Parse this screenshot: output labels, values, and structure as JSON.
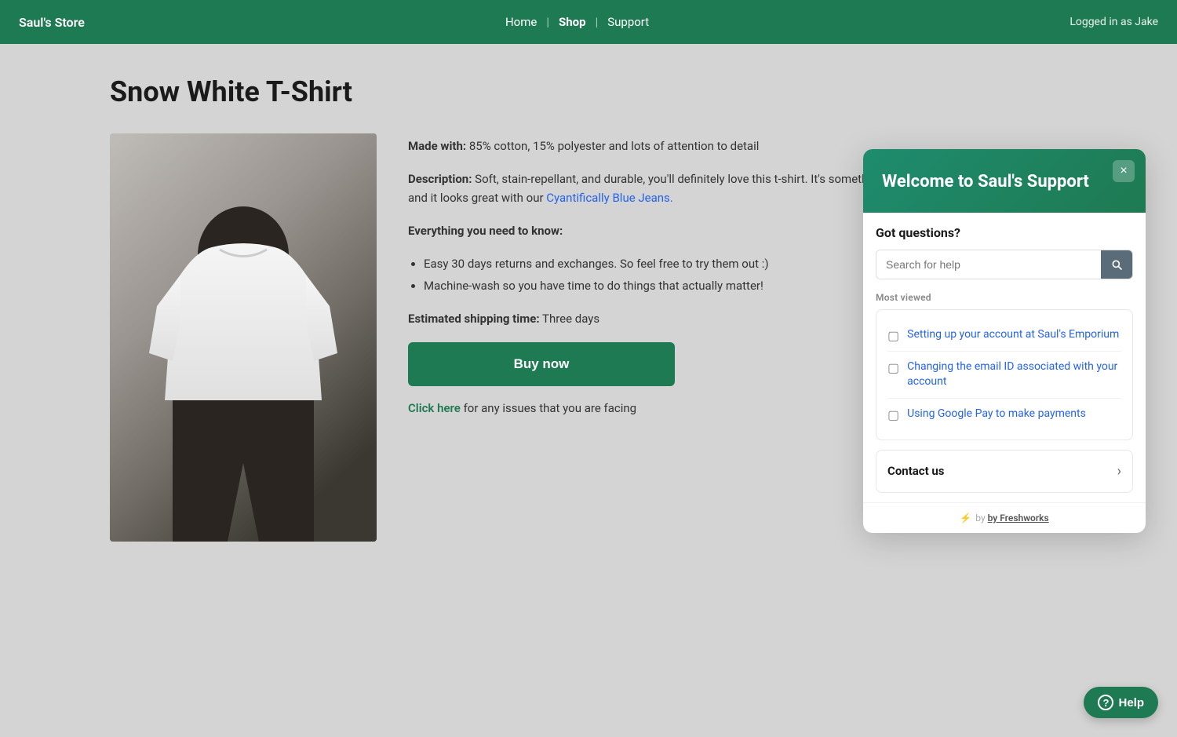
{
  "navbar": {
    "brand": "Saul's Store",
    "nav_items": [
      {
        "label": "Home",
        "active": false
      },
      {
        "label": "Shop",
        "active": true
      },
      {
        "label": "Support",
        "active": false
      }
    ],
    "user_status": "Logged in as Jake"
  },
  "product": {
    "title": "Snow White T-Shirt",
    "made_with_label": "Made with:",
    "made_with_value": "85% cotton, 15% polyester and lots of attention to detail",
    "description_label": "Description:",
    "description_value": "Soft, stain-repellant, and durable, you'll definitely love this t-shirt. It's something you can wear for any occasion, and it looks great with our ",
    "description_link_text": "Cyantifically Blue Jeans.",
    "everything_label": "Everything you need to know:",
    "bullets": [
      "Easy 30 days returns and exchanges. So feel free to try them out :)",
      "Machine-wash so you have time to do things that actually matter!"
    ],
    "shipping_label": "Estimated shipping time:",
    "shipping_value": "Three days",
    "buy_button": "Buy now",
    "issues_text": "for any issues that you are facing",
    "issues_link": "Click here"
  },
  "support_widget": {
    "header_title": "Welcome to Saul's Support",
    "close_label": "×",
    "got_questions": "Got questions?",
    "search_placeholder": "Search for help",
    "most_viewed_label": "Most viewed",
    "articles": [
      {
        "text": "Setting up your account at Saul's Emporium"
      },
      {
        "text": "Changing the email ID associated with your account"
      },
      {
        "text": "Using Google Pay to make payments"
      }
    ],
    "contact_us_label": "Contact us",
    "footer_text": "by Freshworks"
  },
  "help_button": {
    "label": "Help"
  }
}
